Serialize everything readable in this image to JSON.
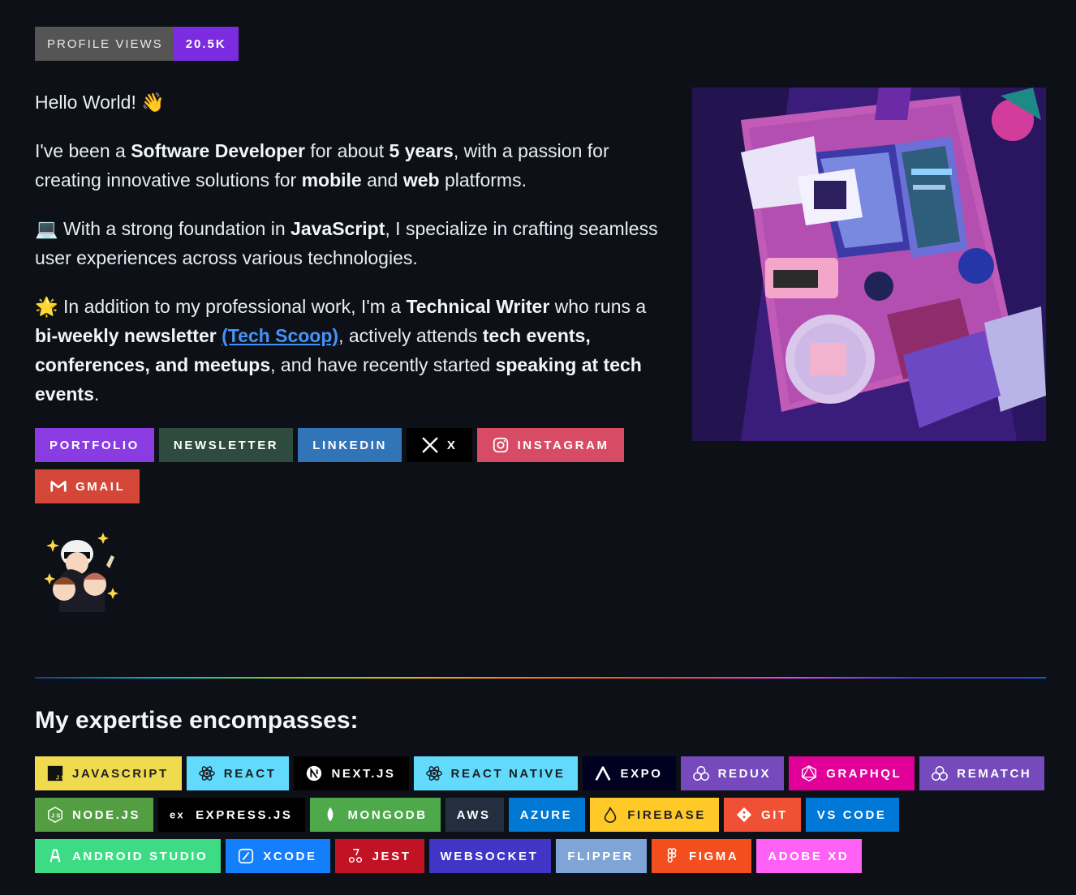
{
  "views": {
    "label": "PROFILE VIEWS",
    "value": "20.5K"
  },
  "intro": {
    "greeting": "Hello World! 👋",
    "p1": [
      "I've been a ",
      "Software Developer",
      " for about ",
      "5 years",
      ", with a passion for creating innovative solutions for ",
      "mobile",
      " and ",
      "web",
      " platforms."
    ],
    "p2": [
      "💻 With a strong foundation in ",
      "JavaScript",
      ", I specialize in crafting seamless user experiences across various technologies."
    ],
    "p3": [
      "🌟 In addition to my professional work, I'm a ",
      "Technical Writer",
      " who runs a ",
      "bi-weekly newsletter",
      " ",
      "(Tech Scoop)",
      ", actively attends ",
      "tech events, conferences, and meetups",
      ", and have recently started ",
      "speaking at tech events",
      "."
    ]
  },
  "social": [
    {
      "label": "PORTFOLIO",
      "color": "#8a3be2",
      "icon": ""
    },
    {
      "label": "NEWSLETTER",
      "color": "#2f4a3e",
      "icon": ""
    },
    {
      "label": "LINKEDIN",
      "color": "#3274b8",
      "icon": ""
    },
    {
      "label": "X",
      "color": "#000000",
      "icon": "x-icon"
    },
    {
      "label": "INSTAGRAM",
      "color": "#d84b64",
      "icon": "instagram-icon"
    },
    {
      "label": "GMAIL",
      "color": "#d44638",
      "icon": "gmail-icon"
    }
  ],
  "divider_colors": [
    "#1e3a8a",
    "#06b6d4",
    "#84cc16",
    "#eab308",
    "#f97316",
    "#ef4444",
    "#d946ef",
    "#4338ca"
  ],
  "expertise": {
    "title": "My expertise encompasses:",
    "items": [
      {
        "label": "JAVASCRIPT",
        "bg": "#f0db4f",
        "fg": "#222222",
        "icon": "javascript-icon"
      },
      {
        "label": "REACT",
        "bg": "#61dafb",
        "fg": "#1b1f24",
        "icon": "react-icon"
      },
      {
        "label": "NEXT.JS",
        "bg": "#000000",
        "fg": "#ffffff",
        "icon": "nextjs-icon"
      },
      {
        "label": "REACT NATIVE",
        "bg": "#61dafb",
        "fg": "#1b1f24",
        "icon": "react-icon"
      },
      {
        "label": "EXPO",
        "bg": "#000020",
        "fg": "#ffffff",
        "icon": "expo-icon"
      },
      {
        "label": "REDUX",
        "bg": "#764abc",
        "fg": "#ffffff",
        "icon": "redux-icon"
      },
      {
        "label": "GRAPHQL",
        "bg": "#e10098",
        "fg": "#ffffff",
        "icon": "graphql-icon"
      },
      {
        "label": "REMATCH",
        "bg": "#764abc",
        "fg": "#ffffff",
        "icon": "redux-icon"
      },
      {
        "label": "NODE.JS",
        "bg": "#539e43",
        "fg": "#ffffff",
        "icon": "nodejs-icon"
      },
      {
        "label": "EXPRESS.JS",
        "bg": "#000000",
        "fg": "#ffffff",
        "icon": "express-icon"
      },
      {
        "label": "MONGODB",
        "bg": "#4ea94b",
        "fg": "#ffffff",
        "icon": "mongodb-icon"
      },
      {
        "label": "AWS",
        "bg": "#232f3e",
        "fg": "#ffffff",
        "icon": ""
      },
      {
        "label": "AZURE",
        "bg": "#0078d4",
        "fg": "#ffffff",
        "icon": ""
      },
      {
        "label": "FIREBASE",
        "bg": "#ffca28",
        "fg": "#222222",
        "icon": "firebase-icon"
      },
      {
        "label": "GIT",
        "bg": "#f05033",
        "fg": "#ffffff",
        "icon": "git-icon"
      },
      {
        "label": "VS CODE",
        "bg": "#0078d7",
        "fg": "#ffffff",
        "icon": ""
      },
      {
        "label": "ANDROID STUDIO",
        "bg": "#3ddc84",
        "fg": "#ffffff",
        "icon": "android-studio-icon"
      },
      {
        "label": "XCODE",
        "bg": "#147efb",
        "fg": "#ffffff",
        "icon": "xcode-icon"
      },
      {
        "label": "JEST",
        "bg": "#c21325",
        "fg": "#ffffff",
        "icon": "jest-icon"
      },
      {
        "label": "WEBSOCKET",
        "bg": "#4135c8",
        "fg": "#ffffff",
        "icon": ""
      },
      {
        "label": "FLIPPER",
        "bg": "#7fa4d6",
        "fg": "#ffffff",
        "icon": ""
      },
      {
        "label": "FIGMA",
        "bg": "#f24e1e",
        "fg": "#ffffff",
        "icon": "figma-icon"
      },
      {
        "label": "ADOBE XD",
        "bg": "#ff61f6",
        "fg": "#ffffff",
        "icon": ""
      }
    ]
  }
}
